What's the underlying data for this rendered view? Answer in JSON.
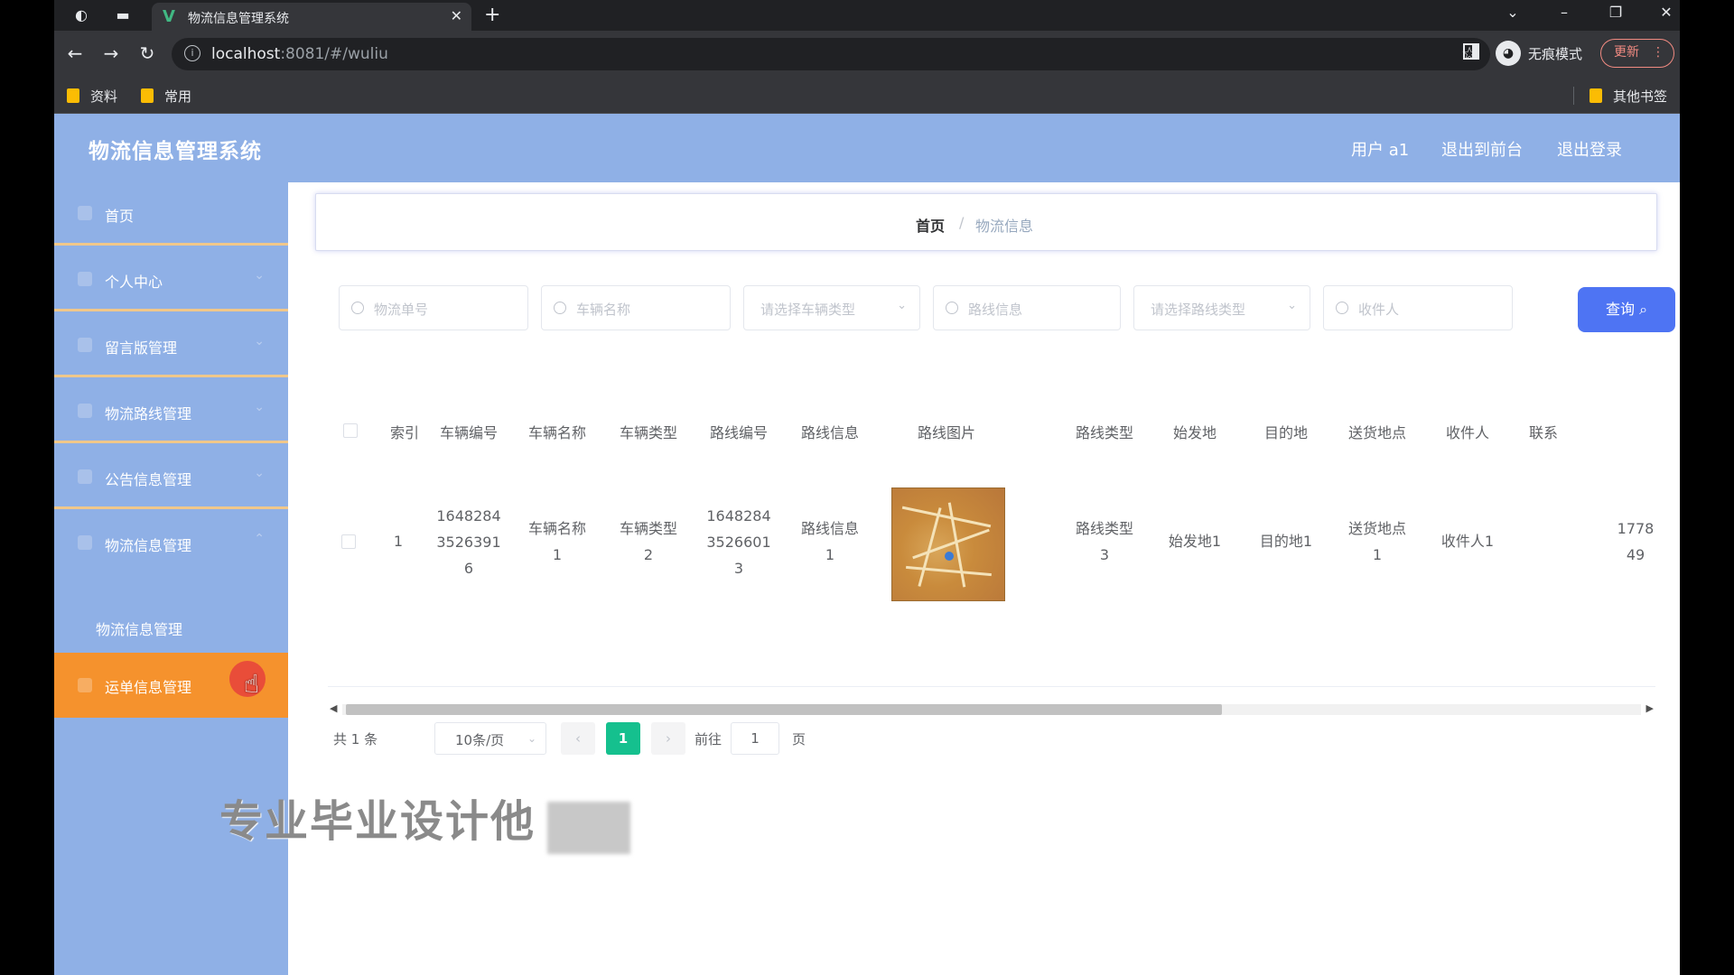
{
  "browser": {
    "tab_title": "物流信息管理系统",
    "tab_logo": "V",
    "url_host": "localhost",
    "url_rest": ":8081/#/wuliu",
    "incognito_label": "无痕模式",
    "update_label": "更新",
    "bookmarks": [
      "资料",
      "常用"
    ],
    "other_bookmarks": "其他书签"
  },
  "app": {
    "title": "物流信息管理系统",
    "header_links": [
      "用户 a1",
      "退出到前台",
      "退出登录"
    ]
  },
  "sidebar": {
    "items": [
      "首页",
      "个人中心",
      "留言版管理",
      "物流路线管理",
      "公告信息管理",
      "物流信息管理"
    ],
    "submenu": "物流信息管理",
    "active": "运单信息管理"
  },
  "breadcrumb": {
    "home": "首页",
    "sep": "/",
    "current": "物流信息"
  },
  "search": {
    "order_no_placeholder": "物流单号",
    "vehicle_name_placeholder": "车辆名称",
    "vehicle_type_placeholder": "请选择车辆类型",
    "route_info_placeholder": "路线信息",
    "route_type_placeholder": "请选择路线类型",
    "recipient_placeholder": "收件人",
    "query_label": "查询"
  },
  "table": {
    "headers": [
      "索引",
      "车辆编号",
      "车辆名称",
      "车辆类型",
      "路线编号",
      "路线信息",
      "路线图片",
      "路线类型",
      "始发地",
      "目的地",
      "送货地点",
      "收件人",
      "联系"
    ],
    "row": {
      "index": "1",
      "vehicle_no": [
        "1648284",
        "3526391",
        "6"
      ],
      "vehicle_name": [
        "车辆名称",
        "1"
      ],
      "vehicle_type": [
        "车辆类型",
        "2"
      ],
      "route_no": [
        "1648284",
        "3526601",
        "3"
      ],
      "route_info": [
        "路线信息",
        "1"
      ],
      "route_type": [
        "路线类型",
        "3"
      ],
      "origin": "始发地1",
      "destination": "目的地1",
      "delivery": [
        "送货地点",
        "1"
      ],
      "recipient": "收件人1",
      "contact": [
        "1778",
        "49"
      ]
    }
  },
  "pagination": {
    "total": "共 1 条",
    "page_size": "10条/页",
    "current_page": "1",
    "goto_label": "前往",
    "goto_value": "1",
    "page_unit": "页"
  },
  "overlay": {
    "watermark": "专业毕业设计他"
  }
}
